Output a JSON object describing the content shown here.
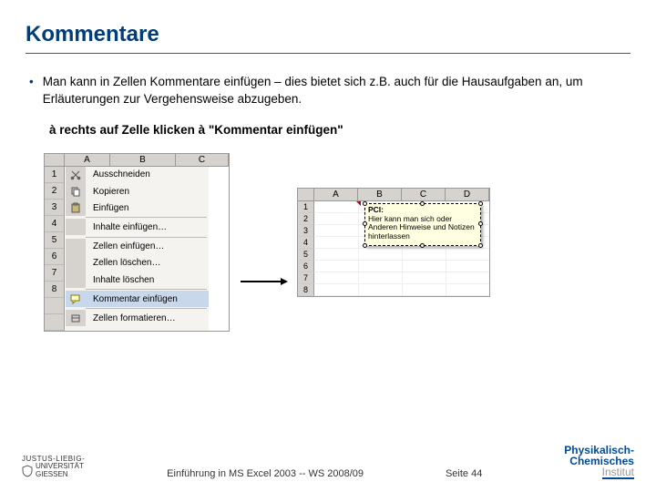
{
  "title": "Kommentare",
  "bullet1": "Man kann in Zellen Kommentare einfügen – dies bietet sich z.B. auch für die Hausaufgaben an, um Erläuterungen zur Vergehensweise abzugeben.",
  "sub": "à rechts auf Zelle klicken  à \"Kommentar einfügen\"",
  "columns": {
    "A": "A",
    "B": "B",
    "C": "C",
    "D": "D"
  },
  "rows": {
    "r1": "1",
    "r2": "2",
    "r3": "3",
    "r4": "4",
    "r5": "5",
    "r6": "6",
    "r7": "7",
    "r8": "8"
  },
  "ctx": {
    "cut": "Ausschneiden",
    "copy": "Kopieren",
    "paste": "Einfügen",
    "paste_special": "Inhalte einfügen…",
    "insert_cells": "Zellen einfügen…",
    "delete_cells": "Zellen löschen…",
    "clear": "Inhalte löschen",
    "insert_comment": "Kommentar einfügen",
    "format": "Zellen formatieren…"
  },
  "comment": {
    "author": "PCI:",
    "text": "Hier kann man sich oder Anderen Hinweise und Notizen hinterlassen"
  },
  "footer": {
    "uni1": "JUSTUS-LIEBIG-",
    "uni2": "UNIVERSITÄT",
    "uni3": "GIESSEN",
    "mid": "Einführung in MS Excel 2003  --  WS 2008/09",
    "page": "Seite 44",
    "pci1": "Physikalisch-",
    "pci2": "Chemisches",
    "pci3": "Institut"
  }
}
